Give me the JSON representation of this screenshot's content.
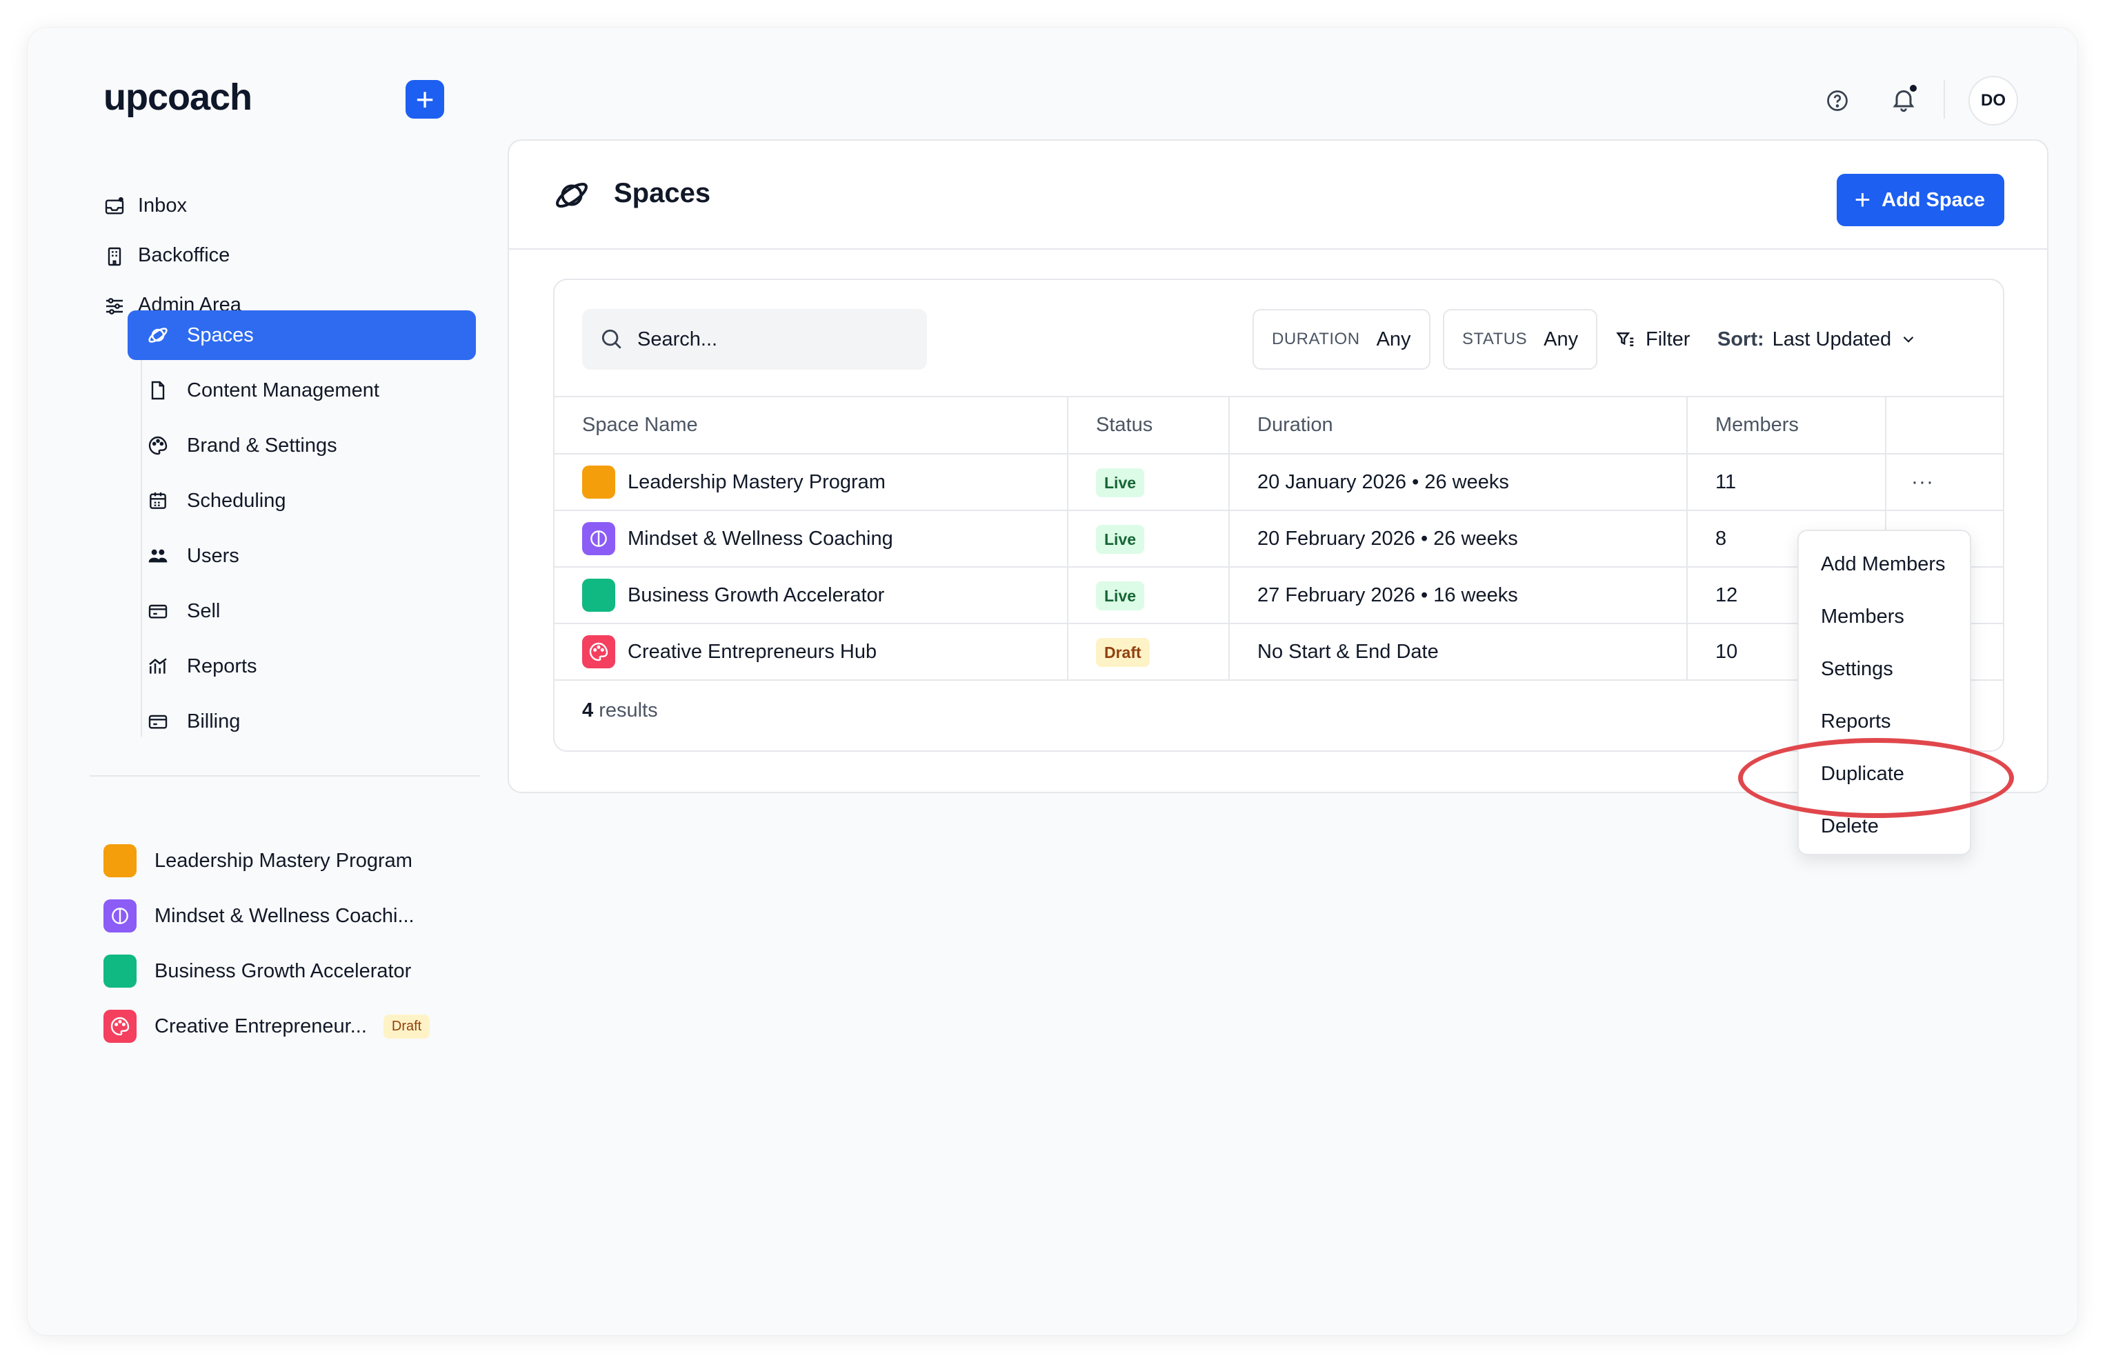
{
  "app": {
    "logo": "upcoach",
    "new_button": "+",
    "avatar_initials": "DO",
    "colors": {
      "primary": "#1d5ff0",
      "active_nav": "#2f6bf0",
      "live_bg": "#dcfce7",
      "draft_bg": "#fef3c7",
      "highlight": "#e0474c"
    }
  },
  "sidebar": {
    "nav": [
      {
        "label": "Inbox",
        "icon": "inbox-icon"
      },
      {
        "label": "Backoffice",
        "icon": "building-icon"
      },
      {
        "label": "Admin Area",
        "icon": "sliders-icon"
      }
    ],
    "admin_items": [
      {
        "label": "Spaces",
        "icon": "planet-icon",
        "active": true
      },
      {
        "label": "Content Management",
        "icon": "file-icon"
      },
      {
        "label": "Brand & Settings",
        "icon": "palette-icon"
      },
      {
        "label": "Scheduling",
        "icon": "calendar-icon"
      },
      {
        "label": "Users",
        "icon": "users-icon"
      },
      {
        "label": "Sell",
        "icon": "card-icon"
      },
      {
        "label": "Reports",
        "icon": "chart-icon"
      },
      {
        "label": "Billing",
        "icon": "card-icon"
      }
    ],
    "spaces": [
      {
        "label": "Leadership Mastery Program",
        "color": "#f59e0b"
      },
      {
        "label": "Mindset & Wellness Coachi...",
        "color": "#8b5cf6"
      },
      {
        "label": "Business Growth Accelerator",
        "color": "#10b981"
      },
      {
        "label": "Creative Entrepreneur...",
        "color": "#f43f5e",
        "badge": "Draft"
      }
    ]
  },
  "page": {
    "title": "Spaces",
    "add_button": "Add Space",
    "search_placeholder": "Search...",
    "filters": {
      "duration_label": "DURATION",
      "duration_value": "Any",
      "status_label": "STATUS",
      "status_value": "Any",
      "filter_label": "Filter",
      "sort_prefix": "Sort:",
      "sort_value": "Last Updated"
    },
    "table": {
      "headers": [
        "Space Name",
        "Status",
        "Duration",
        "Members"
      ],
      "rows": [
        {
          "name": "Leadership Mastery Program",
          "status": "Live",
          "duration": "20 January 2026 • 26 weeks",
          "members": "11",
          "color": "#f59e0b"
        },
        {
          "name": "Mindset & Wellness Coaching",
          "status": "Live",
          "duration": "20 February 2026 • 26 weeks",
          "members": "8",
          "color": "#8b5cf6"
        },
        {
          "name": "Business Growth Accelerator",
          "status": "Live",
          "duration": "27 February 2026 • 16 weeks",
          "members": "12",
          "color": "#10b981"
        },
        {
          "name": "Creative Entrepreneurs Hub",
          "status": "Draft",
          "duration": "No Start & End Date",
          "members": "10",
          "color": "#f43f5e"
        }
      ],
      "row_menu": "···"
    },
    "results_count": "4",
    "results_label": "results"
  },
  "context_menu": {
    "items": [
      "Add Members",
      "Members",
      "Settings",
      "Reports",
      "Duplicate",
      "Delete"
    ],
    "highlighted": "Duplicate"
  }
}
